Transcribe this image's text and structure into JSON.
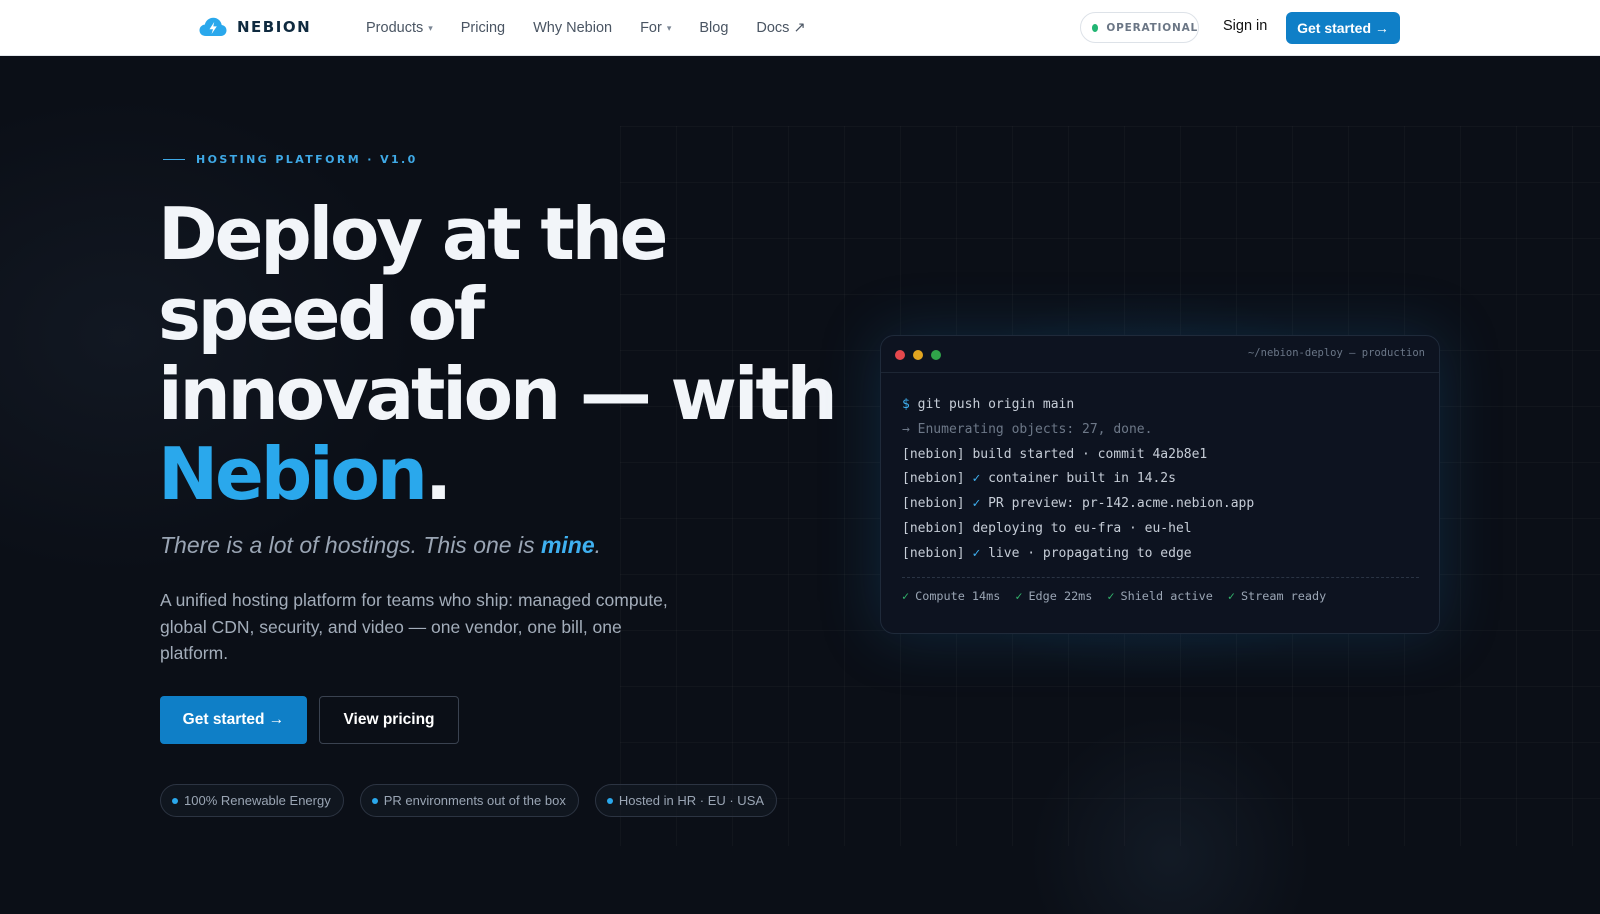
{
  "nav": {
    "brand": "NEBION",
    "links": [
      {
        "label": "Products",
        "caret": "▾"
      },
      {
        "label": "Pricing"
      },
      {
        "label": "Why Nebion"
      },
      {
        "label": "For",
        "caret": "▾"
      },
      {
        "label": "Blog"
      },
      {
        "label": "Docs ↗"
      }
    ],
    "status": "OPERATIONAL",
    "signin": "Sign in",
    "cta": "Get started →"
  },
  "hero": {
    "eyebrow": "HOSTING PLATFORM · V1.0",
    "headline_line1": "Deploy at the",
    "headline_line2": "speed of",
    "headline_line3": "innovation — with",
    "headline_accent": "Nebion",
    "headline_end": ".",
    "tagline_prefix": "There is a lot of hostings. This one is ",
    "tagline_emphasis": "mine",
    "tagline_suffix": ".",
    "description": "A unified hosting platform for teams who ship: managed compute, global CDN, security, and video — one vendor, one bill, one platform.",
    "primary_cta": "Get started →",
    "secondary_cta": "View pricing",
    "badges": [
      "100% Renewable Energy",
      "PR environments out of the box",
      "Hosted in HR · EU · USA"
    ]
  },
  "terminal": {
    "title": "~/nebion-deploy — production",
    "prompt": "$",
    "command": " git push origin main",
    "lines": [
      {
        "text": "→ Enumerating objects: 27, done.",
        "style": "muted"
      },
      {
        "prefix": "[nebion] ",
        "text": "build started · commit 4a2b8e1"
      },
      {
        "prefix": "[nebion] ",
        "check": "✓",
        "text": " container built in 14.2s"
      },
      {
        "prefix": "[nebion] ",
        "check": "✓",
        "text": " PR preview: pr-142.acme.nebion.app"
      },
      {
        "prefix": "[nebion] ",
        "text": "deploying to eu-fra · eu-hel"
      },
      {
        "prefix": "[nebion] ",
        "check": "✓",
        "text": " live · propagating to edge"
      }
    ],
    "stats": [
      {
        "check": "✓",
        "text": "Compute 14ms"
      },
      {
        "check": "✓",
        "text": "Edge 22ms"
      },
      {
        "check": "✓",
        "text": "Shield active"
      },
      {
        "check": "✓",
        "text": "Stream ready"
      }
    ]
  },
  "colors": {
    "accent": "#2aa8ec",
    "button": "#0f7fc7",
    "background": "#0b0f17",
    "status_ok": "#22b573"
  }
}
